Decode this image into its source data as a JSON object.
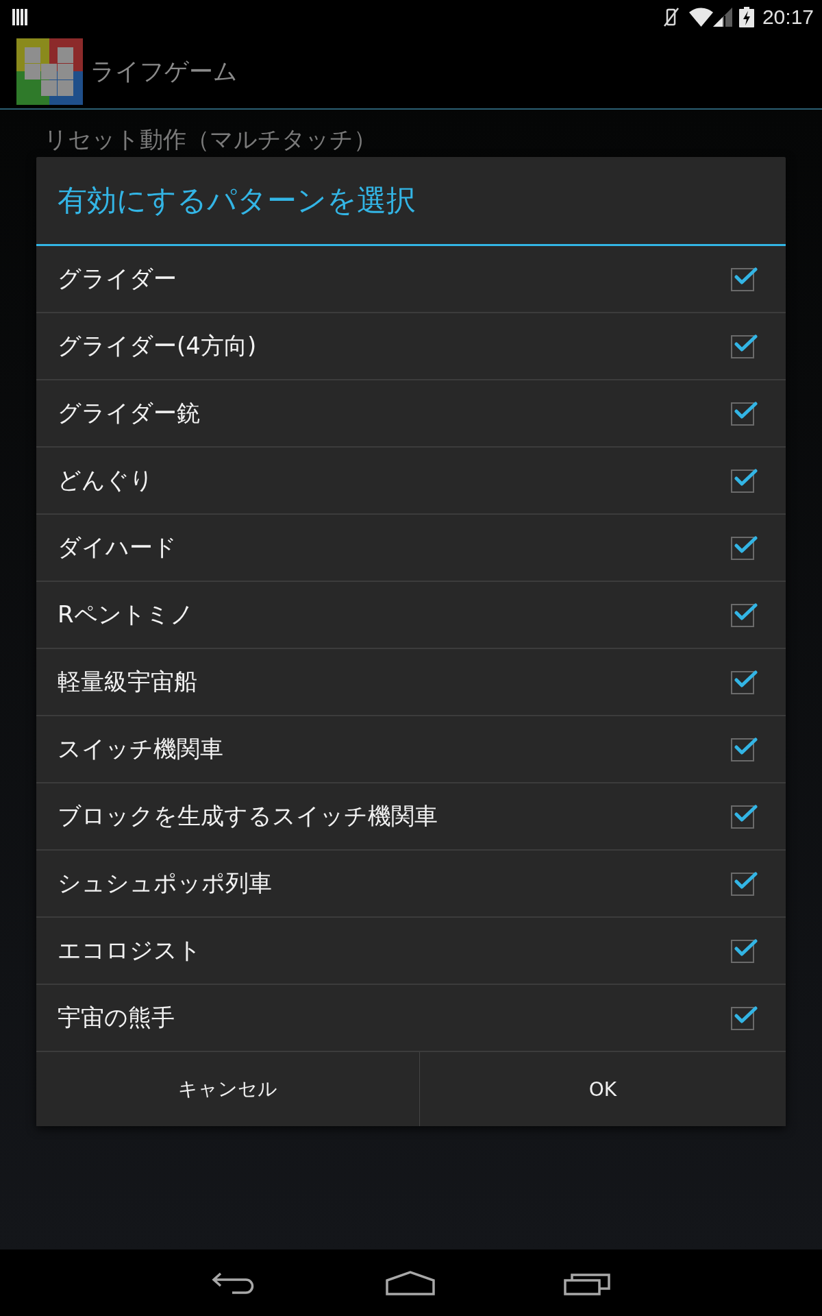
{
  "status_bar": {
    "time": "20:17"
  },
  "action_bar": {
    "title": "ライフゲーム"
  },
  "background": {
    "preference_title": "リセット動作（マルチタッチ）"
  },
  "dialog": {
    "title": "有効にするパターンを選択",
    "options": [
      {
        "label": "グライダー",
        "checked": true
      },
      {
        "label": "グライダー(4方向)",
        "checked": true
      },
      {
        "label": "グライダー銃",
        "checked": true
      },
      {
        "label": "どんぐり",
        "checked": true
      },
      {
        "label": "ダイハード",
        "checked": true
      },
      {
        "label": "Rペントミノ",
        "checked": true
      },
      {
        "label": "軽量級宇宙船",
        "checked": true
      },
      {
        "label": "スイッチ機関車",
        "checked": true
      },
      {
        "label": "ブロックを生成するスイッチ機関車",
        "checked": true
      },
      {
        "label": "シュシュポッポ列車",
        "checked": true
      },
      {
        "label": "エコロジスト",
        "checked": true
      },
      {
        "label": "宇宙の熊手",
        "checked": true
      }
    ],
    "buttons": [
      "キャンセル",
      "OK"
    ]
  }
}
